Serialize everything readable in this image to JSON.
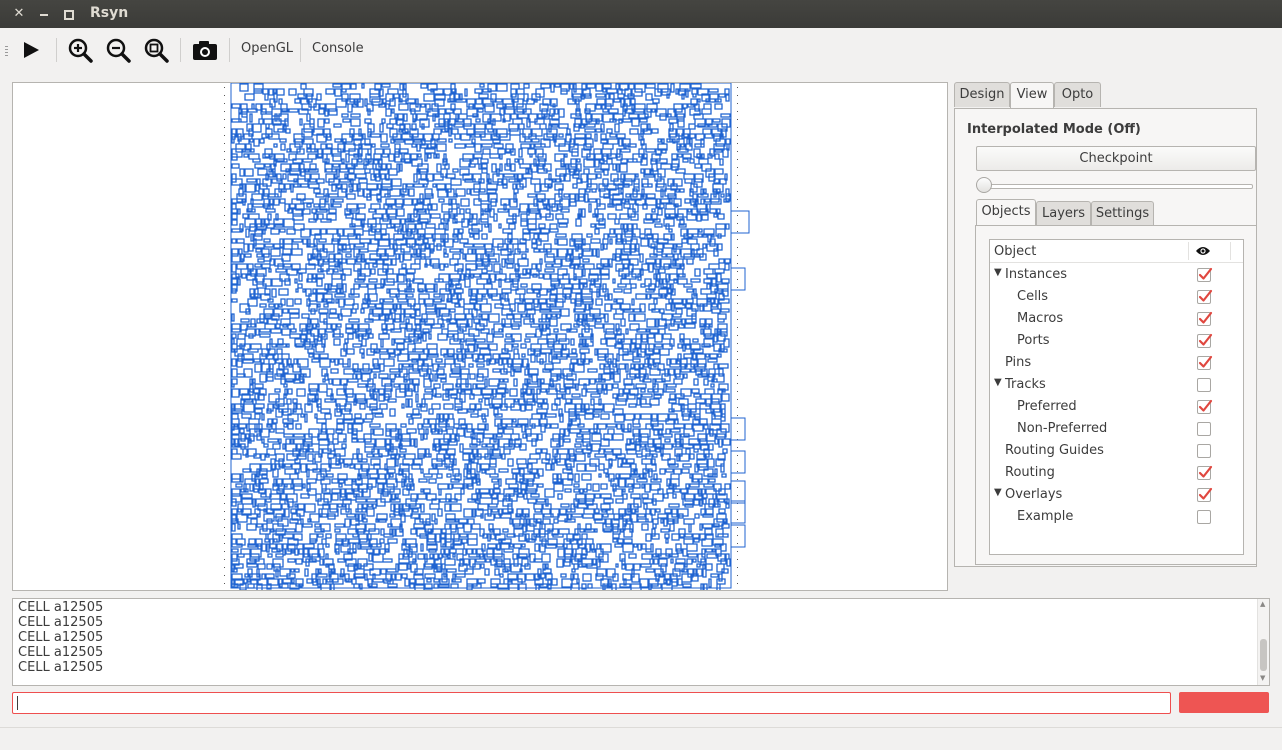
{
  "window": {
    "title": "Rsyn"
  },
  "titlebar": {
    "close_icon": "close-icon",
    "minimize_icon": "minimize-icon",
    "maximize_icon": "maximize-icon"
  },
  "toolbar": {
    "run_icon": "play-icon",
    "zoom_in_icon": "zoom-in-icon",
    "zoom_out_icon": "zoom-out-icon",
    "zoom_fit_icon": "zoom-fit-icon",
    "screenshot_icon": "camera-icon",
    "opengl_label": "OpenGL",
    "console_label": "Console"
  },
  "tabs": {
    "design": "Design",
    "view": "View",
    "opto": "Opto",
    "active": "View"
  },
  "view_panel": {
    "interpolated_mode": "Interpolated Mode (Off)",
    "checkpoint_label": "Checkpoint",
    "slider_value": 0
  },
  "inner_tabs": {
    "objects": "Objects",
    "layers": "Layers",
    "settings": "Settings",
    "active": "Objects"
  },
  "objects_tree": {
    "header_object": "Object",
    "header_visibility_icon": "eye-icon",
    "rows": [
      {
        "label": "Instances",
        "level": 0,
        "expandable": true,
        "checked": true
      },
      {
        "label": "Cells",
        "level": 1,
        "expandable": false,
        "checked": true
      },
      {
        "label": "Macros",
        "level": 1,
        "expandable": false,
        "checked": true
      },
      {
        "label": "Ports",
        "level": 1,
        "expandable": false,
        "checked": true
      },
      {
        "label": "Pins",
        "level": 0,
        "expandable": false,
        "checked": true
      },
      {
        "label": "Tracks",
        "level": 0,
        "expandable": true,
        "checked": false
      },
      {
        "label": "Preferred",
        "level": 1,
        "expandable": false,
        "checked": true
      },
      {
        "label": "Non-Preferred",
        "level": 1,
        "expandable": false,
        "checked": false
      },
      {
        "label": "Routing Guides",
        "level": 0,
        "expandable": false,
        "checked": false
      },
      {
        "label": "Routing",
        "level": 0,
        "expandable": false,
        "checked": true
      },
      {
        "label": "Overlays",
        "level": 0,
        "expandable": true,
        "checked": true
      },
      {
        "label": "Example",
        "level": 1,
        "expandable": false,
        "checked": false
      }
    ]
  },
  "console": {
    "lines": [
      "CELL a12505",
      "CELL a12505",
      "CELL a12505",
      "CELL a12505",
      "CELL a12505"
    ],
    "command_value": ""
  },
  "colors": {
    "cell_outline": "#1f63d1",
    "check_mark": "#e0473f",
    "run_button": "#ee5553",
    "titlebar": "#3f3f3c"
  }
}
